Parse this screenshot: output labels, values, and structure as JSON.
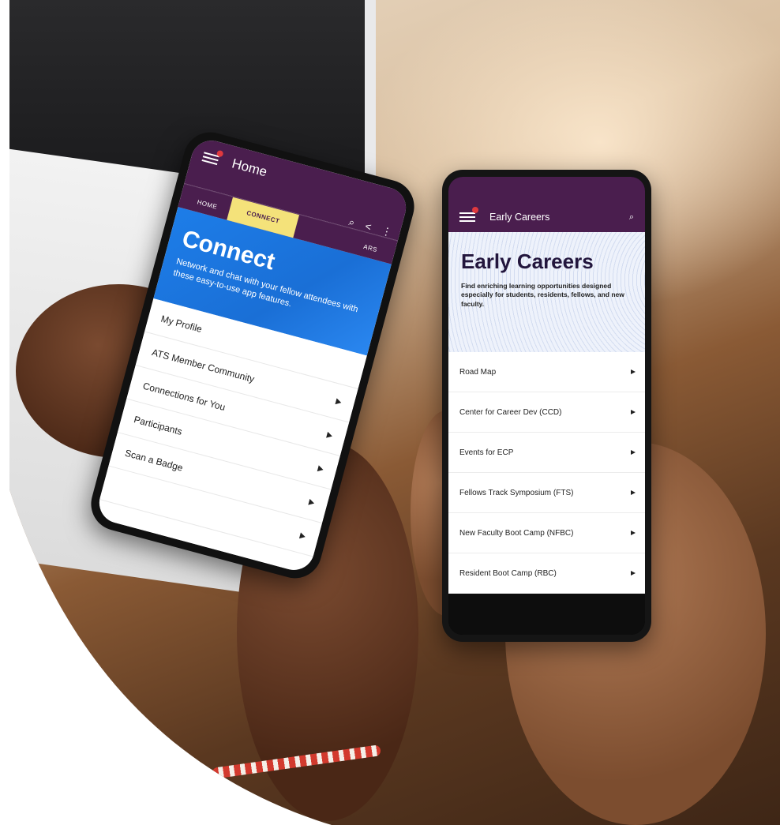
{
  "phone_home": {
    "app_bar": {
      "title": "Home",
      "menu_icon": "hamburger-menu-icon",
      "notification_dot_color": "#e0393e"
    },
    "tabs": [
      {
        "label": "HOME",
        "active": false
      },
      {
        "label": "CONNECT",
        "active": true
      },
      {
        "label": "ARS",
        "active": false
      }
    ],
    "action_icons": [
      "search-icon",
      "share-icon",
      "more-vertical-icon"
    ],
    "hero": {
      "title": "Connect",
      "subtitle": "Network and chat with your fellow attendees with these easy-to-use app features."
    },
    "list": [
      {
        "label": "My Profile",
        "has_arrow": false
      },
      {
        "label": "ATS Member Community",
        "has_arrow": true
      },
      {
        "label": "Connections for You",
        "has_arrow": true
      },
      {
        "label": "Participants",
        "has_arrow": true
      },
      {
        "label": "Scan a Badge",
        "has_arrow": true
      },
      {
        "label": "",
        "has_arrow": true
      }
    ]
  },
  "phone_early_careers": {
    "app_bar": {
      "title": "Early Careers",
      "menu_icon": "hamburger-menu-icon",
      "search_icon": "search-icon"
    },
    "hero": {
      "title": "Early Careers",
      "subtitle": "Find enriching learning opportunities designed especially for students, residents, fellows, and new faculty."
    },
    "list": [
      {
        "label": "Road Map"
      },
      {
        "label": "Center for Career Dev (CCD)"
      },
      {
        "label": "Events for ECP"
      },
      {
        "label": "Fellows Track Symposium (FTS)"
      },
      {
        "label": "New Faculty Boot Camp (NFBC)"
      },
      {
        "label": "Resident Boot Camp (RBC)"
      }
    ]
  },
  "colors": {
    "app_bar_purple": "#4a1e4e",
    "active_tab_yellow": "#f4e27a",
    "connect_hero_blue": "#1d7de8",
    "early_careers_hero_bg": "#eef2fb"
  }
}
